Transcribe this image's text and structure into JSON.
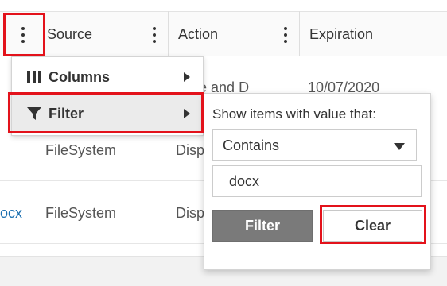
{
  "grid": {
    "columns": [
      {
        "title": "Source"
      },
      {
        "title": "Action"
      },
      {
        "title": "Expiration"
      }
    ],
    "rows": [
      {
        "name": "",
        "source": "",
        "action": "pose and D",
        "expiration": "10/07/2020"
      },
      {
        "name": "",
        "source": "FileSystem",
        "action": "Disp",
        "expiration": ""
      },
      {
        "name": "ocx",
        "source": "FileSystem",
        "action": "Disp",
        "expiration": ""
      }
    ]
  },
  "column_menu": {
    "items": [
      {
        "label": "Columns",
        "icon": "columns-icon"
      },
      {
        "label": "Filter",
        "icon": "filter-icon"
      }
    ]
  },
  "filter_panel": {
    "label": "Show items with value that:",
    "operator": "Contains",
    "value": "docx",
    "filter_button": "Filter",
    "clear_button": "Clear"
  },
  "colors": {
    "highlight": "#e3121b",
    "filter_button_bg": "#7a7a7a",
    "link": "#1a6fb0"
  }
}
